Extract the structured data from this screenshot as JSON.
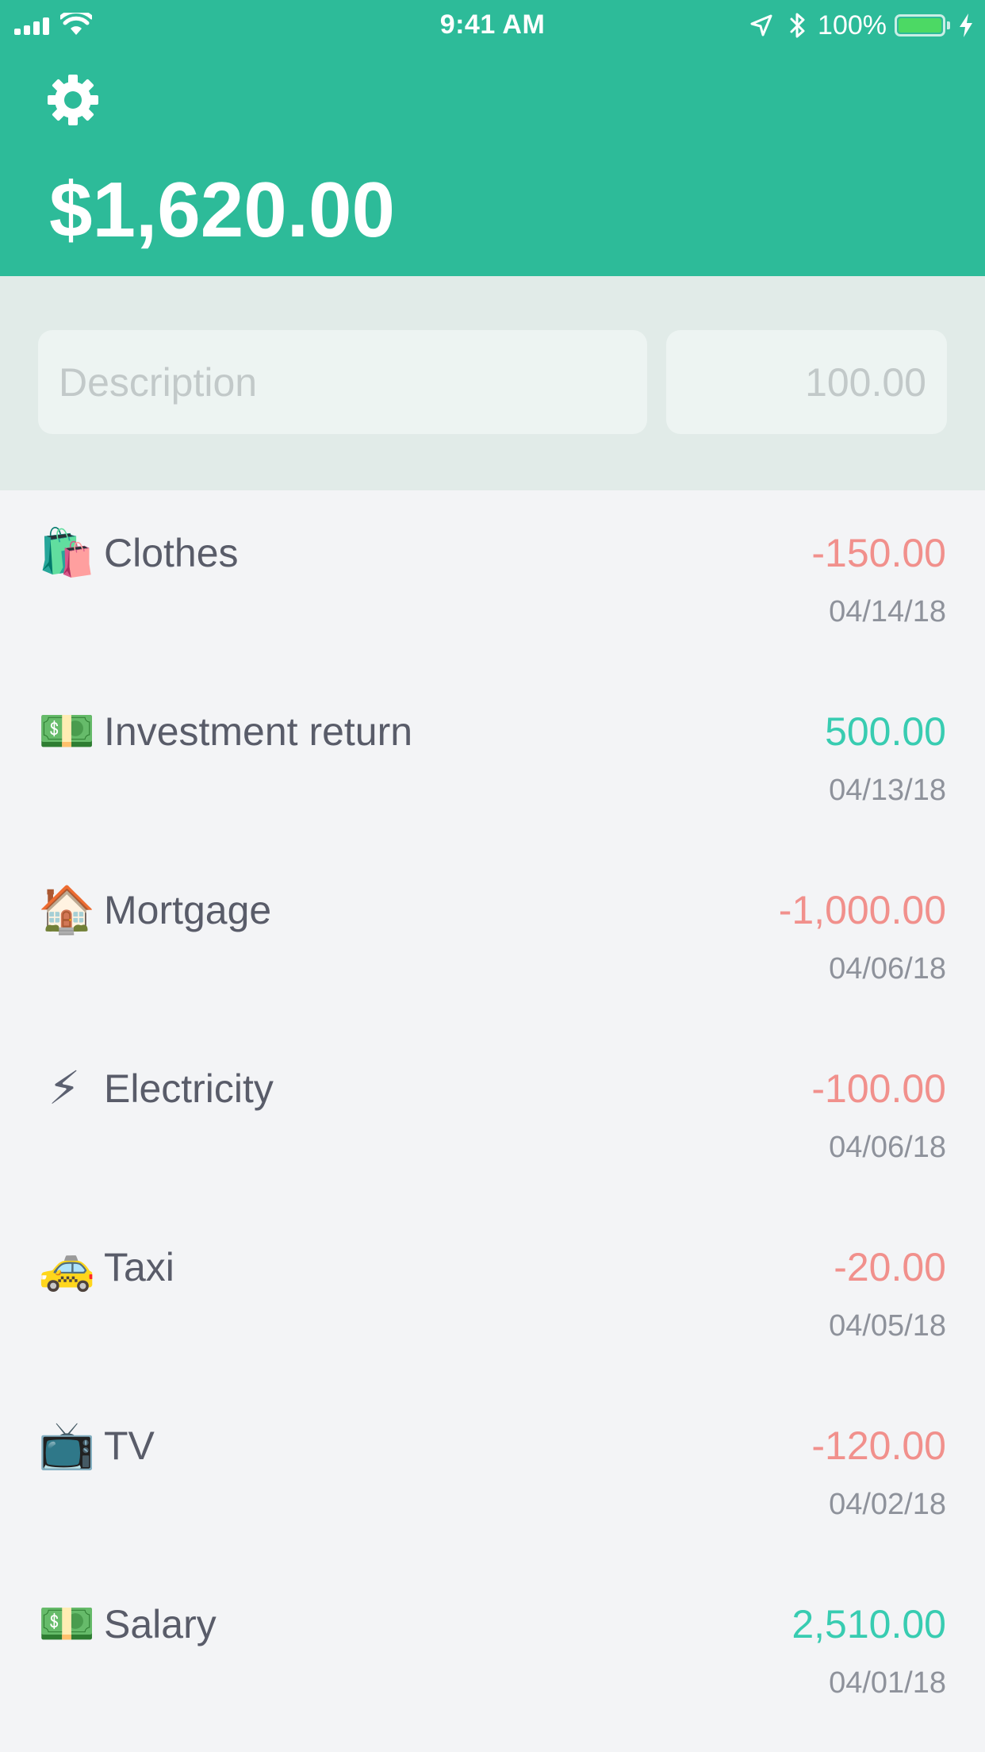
{
  "status_bar": {
    "time": "9:41 AM",
    "battery_percent": "100%",
    "battery_level": 1.0
  },
  "header": {
    "balance": "$1,620.00",
    "settings_icon": "gear-icon",
    "background_color": "#2dbb99"
  },
  "form": {
    "description_placeholder": "Description",
    "description_value": "",
    "amount_placeholder": "100.00",
    "amount_value": ""
  },
  "colors": {
    "negative": "#f1908c",
    "positive": "#38ccb1"
  },
  "transactions": [
    {
      "emoji": "🛍️",
      "icon": "shopping-bags-icon",
      "description": "Clothes",
      "amount": "-150.00",
      "date": "04/14/18",
      "type": "negative"
    },
    {
      "emoji": "💵",
      "icon": "dollar-banknote-icon",
      "description": "Investment return",
      "amount": "500.00",
      "date": "04/13/18",
      "type": "positive"
    },
    {
      "emoji": "🏠",
      "icon": "house-icon",
      "description": "Mortgage",
      "amount": "-1,000.00",
      "date": "04/06/18",
      "type": "negative"
    },
    {
      "emoji": "⚡",
      "icon": "lightning-icon",
      "description": "Electricity",
      "amount": "-100.00",
      "date": "04/06/18",
      "type": "negative"
    },
    {
      "emoji": "🚕",
      "icon": "taxi-icon",
      "description": "Taxi",
      "amount": "-20.00",
      "date": "04/05/18",
      "type": "negative"
    },
    {
      "emoji": "📺",
      "icon": "television-icon",
      "description": "TV",
      "amount": "-120.00",
      "date": "04/02/18",
      "type": "negative"
    },
    {
      "emoji": "💵",
      "icon": "dollar-banknote-icon",
      "description": "Salary",
      "amount": "2,510.00",
      "date": "04/01/18",
      "type": "positive"
    }
  ]
}
